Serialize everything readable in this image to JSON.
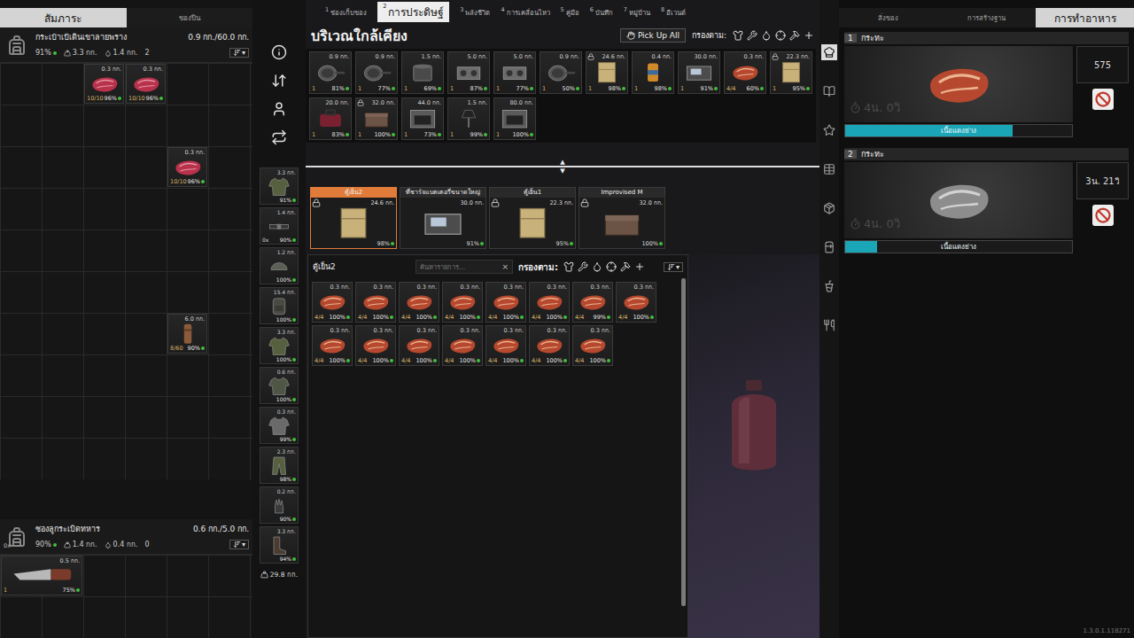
{
  "top_tabs": [
    {
      "number": "1",
      "label": "ช่องเก็บของ",
      "selected": false
    },
    {
      "number": "2",
      "label": "การประดิษฐ์",
      "selected": true
    },
    {
      "number": "3",
      "label": "พลังชีวิต",
      "selected": false
    },
    {
      "number": "4",
      "label": "การเคลื่อนไหว",
      "selected": false
    },
    {
      "number": "5",
      "label": "คู่มือ",
      "selected": false
    },
    {
      "number": "6",
      "label": "บันทึก",
      "selected": false
    },
    {
      "number": "7",
      "label": "หมู่บ้าน",
      "selected": false
    },
    {
      "number": "8",
      "label": "อีเวนต์",
      "selected": false
    }
  ],
  "left_panel": {
    "tabs": [
      {
        "label": "สัมภาระ",
        "selected": true
      },
      {
        "label": "ของปืน",
        "selected": false
      }
    ],
    "containers": [
      {
        "name": "กระเป๋าเป้เดินเขาลายพราง",
        "capacity": "0.9 กก./60.0 กก.",
        "condition": "91%",
        "weight": "3.3 กก.",
        "liquid": "1.4 กก.",
        "count": "2",
        "sort_arrow": "▾",
        "ammo": "",
        "items": [
          {
            "kind": "raw-steak",
            "weight": "0.3 กก.",
            "stack": "10/10",
            "condition": "96%"
          },
          {
            "kind": "raw-steak",
            "weight": "0.3 กก.",
            "stack": "10/10",
            "condition": "96%"
          },
          {
            "kind": "raw-steak",
            "weight": "0.3 กก.",
            "stack": "10/10",
            "condition": "96%"
          },
          {
            "kind": "grinder",
            "weight": "6.0 กก.",
            "stack": "8/60",
            "condition": "90%"
          }
        ]
      },
      {
        "name": "ซองลูกระเบิดทหาร",
        "capacity": "0.6 กก./5.0 กก.",
        "condition": "90%",
        "weight": "1.4 กก.",
        "liquid": "0.4 กก.",
        "count": "0",
        "sort_arrow": "▾",
        "ammo": "0x",
        "items": [
          {
            "kind": "knife",
            "weight": "0.5 กก.",
            "stack": "1",
            "condition": "75%"
          }
        ]
      }
    ]
  },
  "equipment": {
    "items": [
      {
        "kind": "vest",
        "weight": "3.3 กก.",
        "condition": "91%",
        "ammo": ""
      },
      {
        "kind": "belt",
        "weight": "1.4 กก.",
        "condition": "90%",
        "ammo": "0x"
      },
      {
        "kind": "helmet",
        "weight": "1.2 กก.",
        "condition": "100%",
        "ammo": ""
      },
      {
        "kind": "backpack",
        "weight": "15.4 กก.",
        "condition": "100%",
        "ammo": ""
      },
      {
        "kind": "jacket",
        "weight": "3.3 กก.",
        "condition": "100%",
        "ammo": ""
      },
      {
        "kind": "shirt",
        "weight": "0.6 กก.",
        "condition": "100%",
        "ammo": ""
      },
      {
        "kind": "tshirt",
        "weight": "0.3 กก.",
        "condition": "99%",
        "ammo": ""
      },
      {
        "kind": "pants",
        "weight": "2.3 กก.",
        "condition": "98%",
        "ammo": ""
      },
      {
        "kind": "gloves",
        "weight": "0.2 กก.",
        "condition": "90%",
        "ammo": ""
      },
      {
        "kind": "boots",
        "weight": "3.3 กก.",
        "condition": "94%",
        "ammo": ""
      }
    ],
    "total_weight": "29.8 กก."
  },
  "nearby": {
    "title": "บริเวณใกล้เคียง",
    "pick_up_all": "Pick Up All",
    "filter_label": "กรองตาม:",
    "items": [
      {
        "kind": "pan",
        "weight": "0.9 กก.",
        "stack": "1",
        "condition": "81%",
        "locked": false
      },
      {
        "kind": "pan",
        "weight": "0.9 กก.",
        "stack": "1",
        "condition": "77%",
        "locked": false
      },
      {
        "kind": "pot",
        "weight": "1.5 กก.",
        "stack": "1",
        "condition": "69%",
        "locked": false
      },
      {
        "kind": "stove",
        "weight": "5.0 กก.",
        "stack": "1",
        "condition": "87%",
        "locked": false
      },
      {
        "kind": "stove",
        "weight": "5.0 กก.",
        "stack": "1",
        "condition": "77%",
        "locked": false
      },
      {
        "kind": "pan",
        "weight": "0.9 กก.",
        "stack": "1",
        "condition": "50%",
        "locked": false
      },
      {
        "kind": "fridge",
        "weight": "24.6 กก.",
        "stack": "1",
        "condition": "98%",
        "locked": true
      },
      {
        "kind": "can",
        "weight": "0.4 กก.",
        "stack": "1",
        "condition": "98%",
        "locked": false
      },
      {
        "kind": "charger",
        "weight": "30.0 กก.",
        "stack": "1",
        "condition": "91%",
        "locked": false
      },
      {
        "kind": "cooked-steak",
        "weight": "0.3 กก.",
        "stack": "4/4",
        "condition": "60%",
        "locked": false
      },
      {
        "kind": "fridge",
        "weight": "22.3 กก.",
        "stack": "1",
        "condition": "95%",
        "locked": true
      },
      {
        "kind": "bag",
        "weight": "20.0 กก.",
        "stack": "1",
        "condition": "83%",
        "locked": false
      },
      {
        "kind": "chest",
        "weight": "32.0 กก.",
        "stack": "1",
        "condition": "100%",
        "locked": true
      },
      {
        "kind": "oven",
        "weight": "44.0 กก.",
        "stack": "1",
        "condition": "73%",
        "locked": false
      },
      {
        "kind": "lamp",
        "weight": "1.5 กก.",
        "stack": "1",
        "condition": "99%",
        "locked": false
      },
      {
        "kind": "oven",
        "weight": "80.0 กก.",
        "stack": "1",
        "condition": "100%",
        "locked": false
      }
    ]
  },
  "divider_handle": {
    "up": "▲",
    "down": "▼"
  },
  "container_tabs": [
    {
      "name": "ตู้เย็น2",
      "kind": "fridge",
      "weight": "24.6 กก.",
      "condition": "98%",
      "locked": true,
      "selected": true
    },
    {
      "name": "ที่ชาร์จแบตเตอรี่ขนาดใหญ่",
      "kind": "charger",
      "weight": "30.0 กก.",
      "condition": "91%",
      "locked": false,
      "selected": false
    },
    {
      "name": "ตู้เย็น1",
      "kind": "fridge",
      "weight": "22.3 กก.",
      "condition": "95%",
      "locked": true,
      "selected": false
    },
    {
      "name": "Improvised M",
      "kind": "chest",
      "weight": "32.0 กก.",
      "condition": "100%",
      "locked": true,
      "selected": false
    }
  ],
  "fridge_panel": {
    "title": "ตู้เย็น2",
    "search_placeholder": "ค้นหารายการ...",
    "clear": "×",
    "filter_label": "กรองตาม:",
    "sort_arrow": "▾",
    "items": [
      {
        "kind": "cooked-steak",
        "weight": "0.3 กก.",
        "stack": "4/4",
        "condition": "100%"
      },
      {
        "kind": "cooked-steak",
        "weight": "0.3 กก.",
        "stack": "4/4",
        "condition": "100%"
      },
      {
        "kind": "cooked-steak",
        "weight": "0.3 กก.",
        "stack": "4/4",
        "condition": "100%"
      },
      {
        "kind": "cooked-steak",
        "weight": "0.3 กก.",
        "stack": "4/4",
        "condition": "100%"
      },
      {
        "kind": "cooked-steak",
        "weight": "0.3 กก.",
        "stack": "4/4",
        "condition": "100%"
      },
      {
        "kind": "cooked-steak",
        "weight": "0.3 กก.",
        "stack": "4/4",
        "condition": "100%"
      },
      {
        "kind": "cooked-steak",
        "weight": "0.3 กก.",
        "stack": "4/4",
        "condition": "99%"
      },
      {
        "kind": "cooked-steak",
        "weight": "0.3 กก.",
        "stack": "4/4",
        "condition": "100%"
      },
      {
        "kind": "cooked-steak",
        "weight": "0.3 กก.",
        "stack": "4/4",
        "condition": "100%"
      },
      {
        "kind": "cooked-steak",
        "weight": "0.3 กก.",
        "stack": "4/4",
        "condition": "100%"
      },
      {
        "kind": "cooked-steak",
        "weight": "0.3 กก.",
        "stack": "4/4",
        "condition": "100%"
      },
      {
        "kind": "cooked-steak",
        "weight": "0.3 กก.",
        "stack": "4/4",
        "condition": "100%"
      },
      {
        "kind": "cooked-steak",
        "weight": "0.3 กก.",
        "stack": "4/4",
        "condition": "100%"
      },
      {
        "kind": "cooked-steak",
        "weight": "0.3 กก.",
        "stack": "4/4",
        "condition": "100%"
      },
      {
        "kind": "cooked-steak",
        "weight": "0.3 กก.",
        "stack": "4/4",
        "condition": "100%"
      }
    ]
  },
  "right_panel": {
    "tabs": [
      {
        "label": "สิ่งของ",
        "selected": false
      },
      {
        "label": "การสร้างฐาน",
        "selected": false
      },
      {
        "label": "การทำอาหาร",
        "selected": true
      }
    ],
    "cooking_slots": [
      {
        "number": "1",
        "title": "กระทะ",
        "kind": "cooked-steak",
        "time": "4น. 0วิ",
        "side": "575",
        "level": 0.74,
        "label": "เนื้อแดงย่าง"
      },
      {
        "number": "2",
        "title": "กระทะ",
        "kind": "grey-steak",
        "time": "4น. 0วิ",
        "side": "3น. 21วิ",
        "level": 0.14,
        "label": "เนื้อแดงย่าง"
      }
    ]
  },
  "version": "1.3.0.1.118271"
}
